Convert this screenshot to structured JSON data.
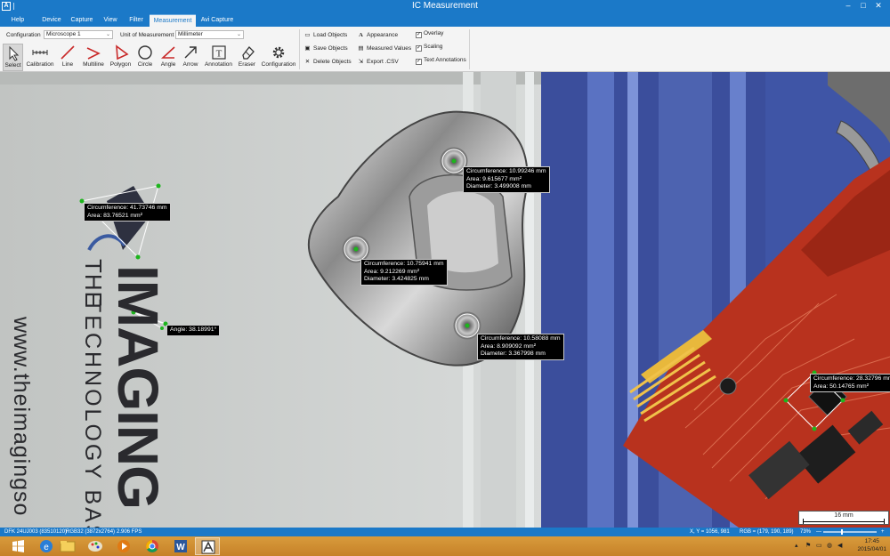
{
  "window": {
    "title": "IC Measurement",
    "app_icon": "A",
    "controls": [
      "–",
      "□",
      "✕"
    ]
  },
  "menu": {
    "tabs": [
      "Help",
      "Device",
      "Capture",
      "View",
      "Filter",
      "Measurement",
      "Avi Capture"
    ],
    "active": "Measurement"
  },
  "ribbon": {
    "configuration_label": "Configuration",
    "configuration_value": "Microscope 1",
    "unit_label": "Unit of Measurement",
    "unit_value": "Millimeter",
    "tools": [
      "Select",
      "Calibration",
      "Line",
      "Multiline",
      "Polygon",
      "Circle",
      "Angle",
      "Arrow",
      "Annotation",
      "Eraser",
      "Configuration"
    ],
    "selected_tool": "Select",
    "objects": [
      "Load Objects",
      "Save Objects",
      "Delete Objects"
    ],
    "results": [
      "Appearance",
      "Measured Values",
      "Export .CSV"
    ],
    "options": [
      {
        "label": "Overlay",
        "checked": true
      },
      {
        "label": "Scaling",
        "checked": true
      },
      {
        "label": "Text Annotations",
        "checked": true
      }
    ]
  },
  "canvas": {
    "logo_the": "THE",
    "logo_imaging": "IMAGING",
    "logo_sub": "TECHNOLOGY BAS",
    "logo_url": "www.theimagingso",
    "annotations": {
      "polygon": [
        "Circumference: 41.73746 mm",
        "Area: 83.76521 mm²"
      ],
      "angle": [
        "Angle: 38.18991°"
      ],
      "circle_top": [
        "Circumference: 10.99246 mm",
        "Area: 9.615677 mm²",
        "Diameter: 3.499008 mm"
      ],
      "circle_mid": [
        "Circumference: 10.75941 mm",
        "Area: 9.212269 mm²",
        "Diameter: 3.424825 mm"
      ],
      "circle_bottom": [
        "Circumference: 10.58088 mm",
        "Area: 8.909092 mm²",
        "Diameter: 3.367998 mm"
      ],
      "square": [
        "Circumference: 28.32796 mm",
        "Area: 50.14765 mm²"
      ]
    },
    "scale_bar": "16 mm"
  },
  "status": {
    "device": "DFK 24UJ003 (83510120)",
    "format": "RGB32 (3872x2764)",
    "fps": "2.906 FPS",
    "coords": "X, Y = 1056, 981",
    "rgb": "RGB = (179, 190, 189)",
    "zoom": "73%",
    "zoom_minus": "—",
    "zoom_plus": "+"
  },
  "taskbar": {
    "time": "17:45",
    "date": "2015/04/01"
  },
  "colors": {
    "title_blue": "#1b79c8",
    "marker_green": "#1db51d",
    "annotation_bg": "#000000",
    "pcb_red": "#b8321e"
  }
}
